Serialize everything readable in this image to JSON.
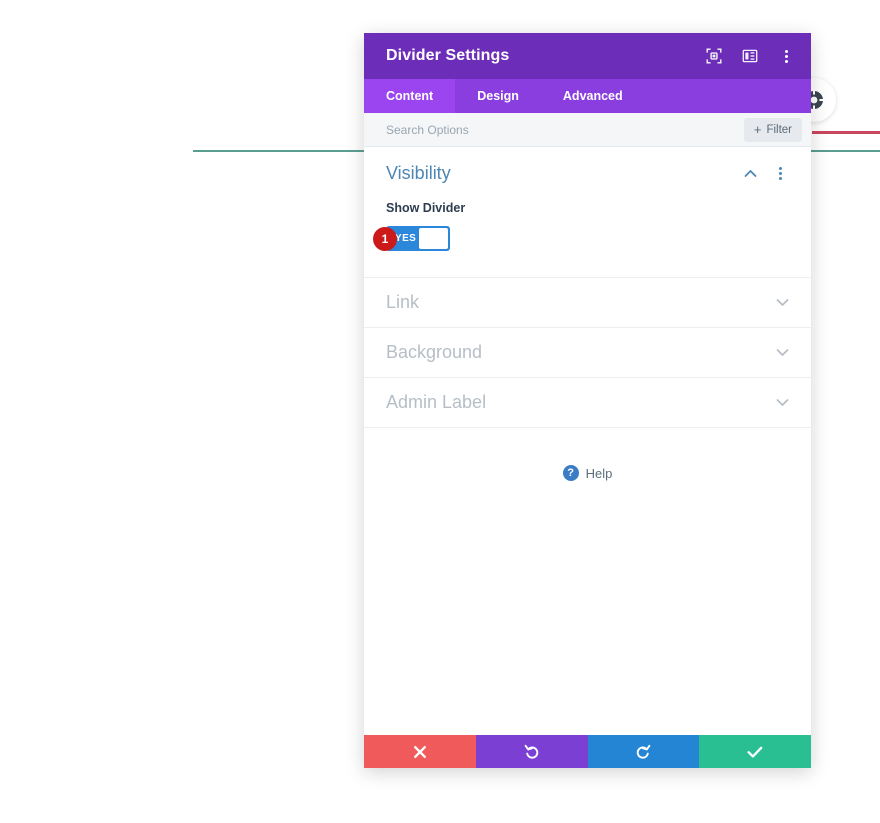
{
  "page": {
    "background_color": "#ffffff",
    "canvas_artifacts": {
      "teal_divider_color": "#5a9e92",
      "red_divider_color": "#c9465c",
      "module_bubble_icon": "settings-gear-icon"
    }
  },
  "modal": {
    "title": "Divider Settings",
    "header_color": "#6c2eb9",
    "header_icons": [
      {
        "name": "focus-module-icon",
        "label": "Focus Module"
      },
      {
        "name": "layout-panel-icon",
        "label": "Change Modal Position"
      },
      {
        "name": "more-options-icon",
        "label": "More Options"
      }
    ],
    "tabs": [
      {
        "label": "Content",
        "active": true
      },
      {
        "label": "Design",
        "active": false
      },
      {
        "label": "Advanced",
        "active": false
      }
    ],
    "tab_bar_color": "#8b3ee0",
    "active_tab_color": "#9b45f0",
    "search": {
      "value": "",
      "placeholder": "Search Options"
    },
    "filter_button": {
      "label": "Filter",
      "plus": "+"
    },
    "groups": [
      {
        "title": "Visibility",
        "state": "open",
        "title_color": "#4c87b5",
        "toggle_icon": "chevron-up-icon",
        "menu_icon": "more-options-icon",
        "fields": [
          {
            "label": "Show Divider",
            "type": "yes-no-toggle",
            "value": "YES",
            "toggle_color": "#2b87da",
            "step_badge": "1",
            "badge_color": "#cc1919"
          }
        ]
      },
      {
        "title": "Link",
        "state": "closed",
        "toggle_icon": "chevron-down-icon"
      },
      {
        "title": "Background",
        "state": "closed",
        "toggle_icon": "chevron-down-icon"
      },
      {
        "title": "Admin Label",
        "state": "closed",
        "toggle_icon": "chevron-down-icon"
      }
    ],
    "help": {
      "label": "Help",
      "icon": "question-mark-icon",
      "icon_color": "#3a7dc4"
    },
    "footer_actions": [
      {
        "name": "cancel-button",
        "icon": "close-x-icon",
        "color": "#f05a5a"
      },
      {
        "name": "undo-button",
        "icon": "undo-arrow-icon",
        "color": "#7b3fd4"
      },
      {
        "name": "redo-button",
        "icon": "redo-arrow-icon",
        "color": "#2485d4"
      },
      {
        "name": "save-button",
        "icon": "checkmark-icon",
        "color": "#29bf93"
      }
    ]
  }
}
